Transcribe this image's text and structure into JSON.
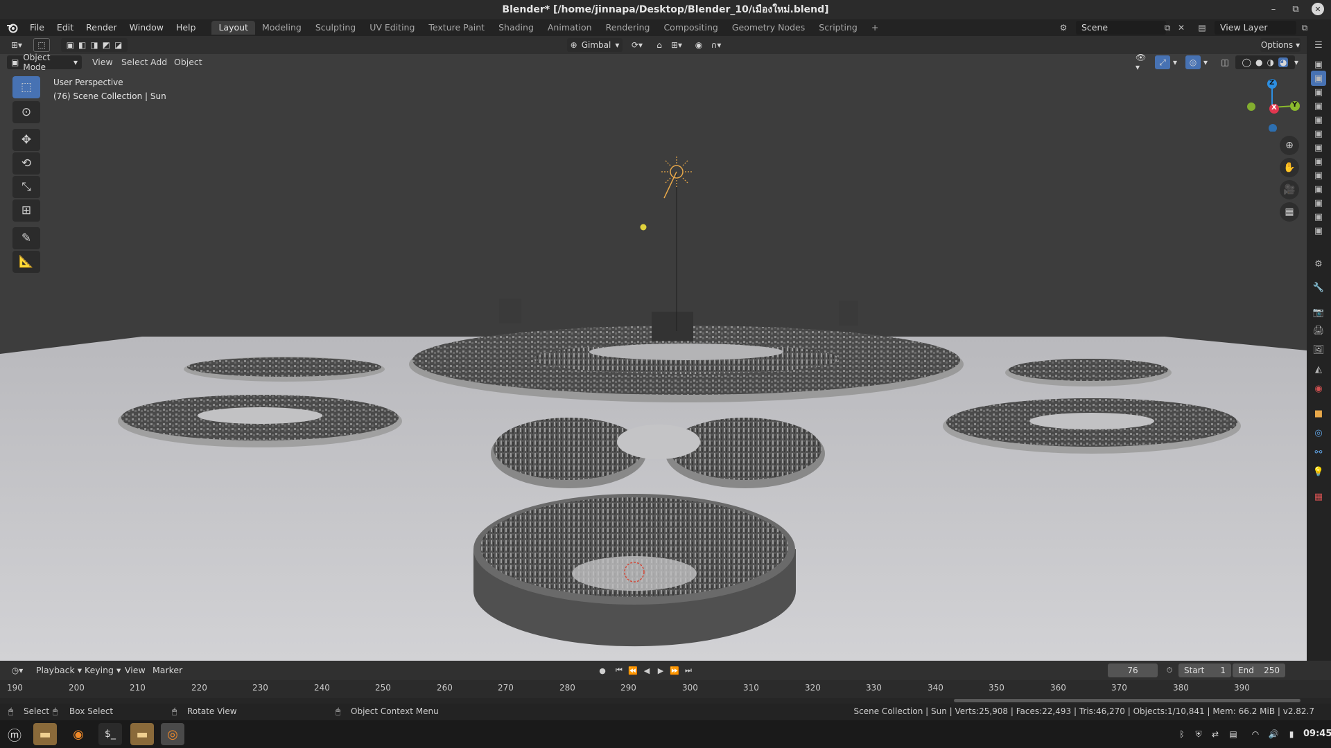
{
  "window": {
    "title": "Blender* [/home/jinnapa/Desktop/Blender_10/เมืองใหม่.blend]"
  },
  "menubar": {
    "menus": [
      "File",
      "Edit",
      "Render",
      "Window",
      "Help"
    ],
    "workspaces": [
      "Layout",
      "Modeling",
      "Sculpting",
      "UV Editing",
      "Texture Paint",
      "Shading",
      "Animation",
      "Rendering",
      "Compositing",
      "Geometry Nodes",
      "Scripting"
    ],
    "active_workspace": "Layout",
    "add_tab": "+",
    "scene_name": "Scene",
    "view_layer_name": "View Layer"
  },
  "toolheader": {
    "orientation": "Gimbal",
    "options_label": "Options"
  },
  "viewheader": {
    "mode": "Object Mode",
    "menus": [
      "View",
      "Select",
      "Add",
      "Object"
    ]
  },
  "viewport": {
    "perspective_label": "User Perspective",
    "collection_label": "(76) Scene Collection | Sun",
    "gizmo_axes": {
      "z": "Z",
      "x": "X",
      "y": "Y"
    },
    "axis_colors": {
      "x": "#e2364f",
      "y": "#8bba2d",
      "z": "#2d8fe2"
    }
  },
  "timeline": {
    "menus": [
      "Playback",
      "Keying",
      "View",
      "Marker"
    ],
    "current_frame": "76",
    "start_label": "Start",
    "start_value": "1",
    "end_label": "End",
    "end_value": "250",
    "ruler": [
      "190",
      "200",
      "210",
      "220",
      "230",
      "240",
      "250",
      "260",
      "270",
      "280",
      "290",
      "300",
      "310",
      "320",
      "330",
      "340",
      "350",
      "360",
      "370",
      "380",
      "390"
    ]
  },
  "statusbar": {
    "select": "Select",
    "box_select": "Box Select",
    "rotate_view": "Rotate View",
    "context_menu": "Object Context Menu",
    "stats": "Scene Collection | Sun | Verts:25,908 | Faces:22,493 | Tris:46,270 | Objects:1/10,841 | Mem: 66.2 MiB | v2.82.7"
  },
  "taskbar": {
    "clock": "09:45"
  },
  "colors": {
    "accent": "#4772b3",
    "viewport_bg": "#3d3d3d",
    "ground": "#c9c9cc",
    "sun": "#e8a84a"
  }
}
